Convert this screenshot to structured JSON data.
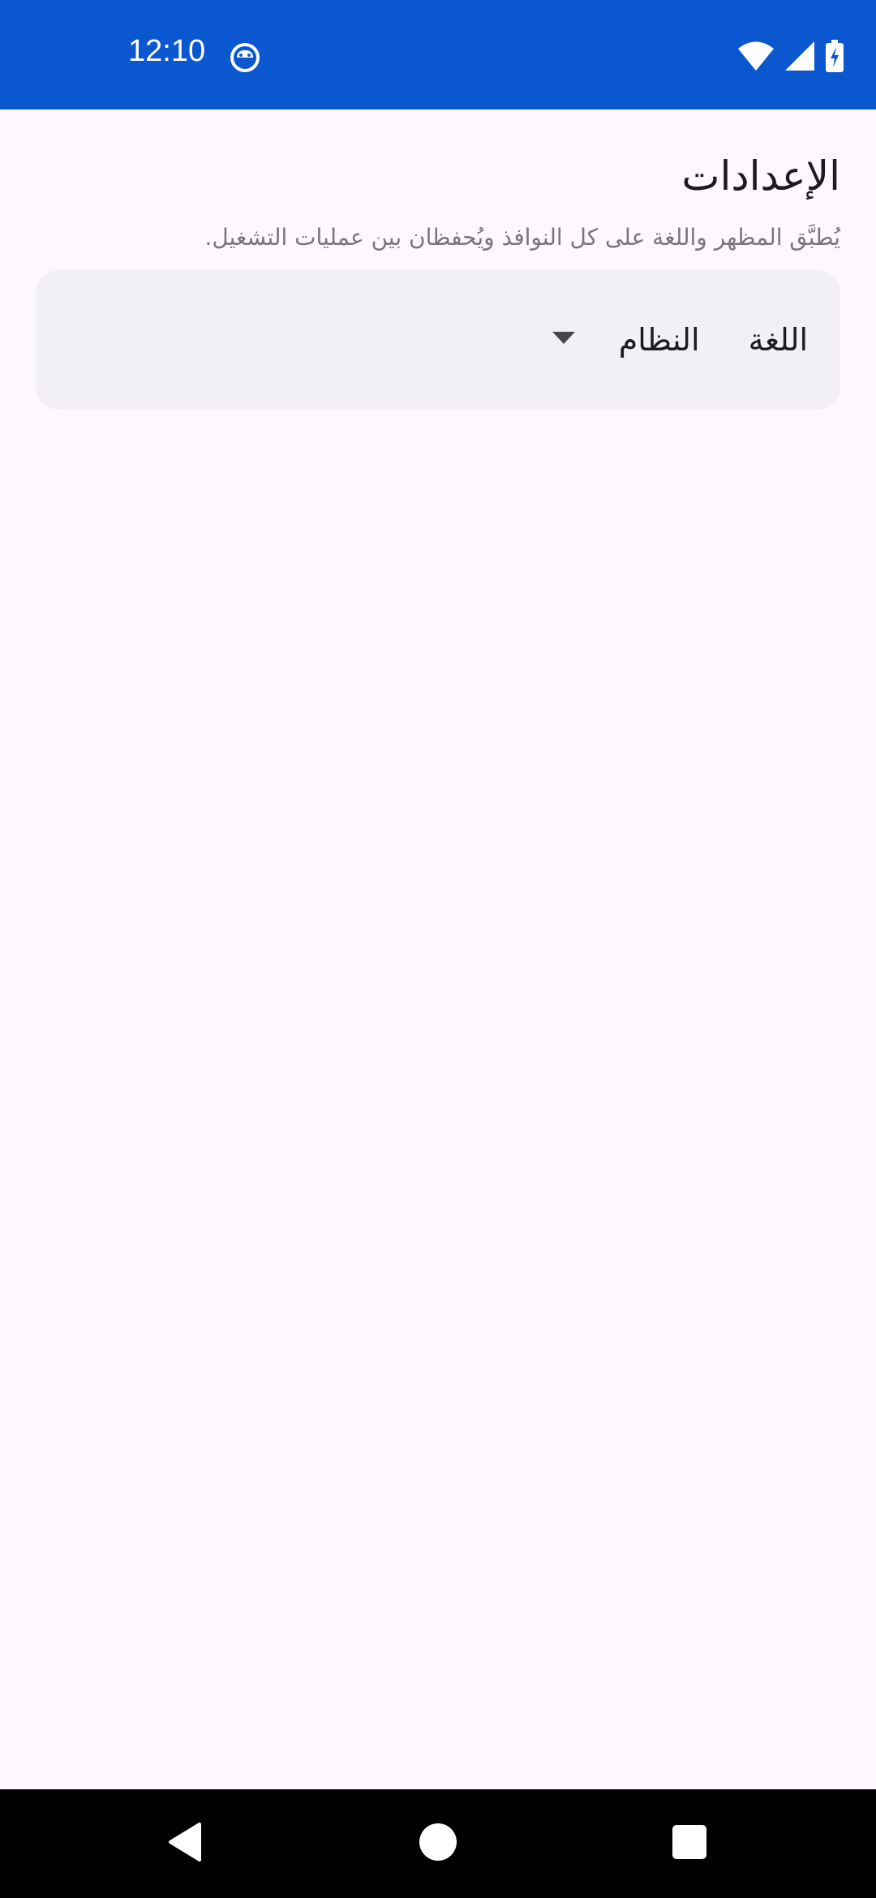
{
  "status_bar": {
    "time": "12:10",
    "background_color": "#0b57d0",
    "icons": [
      "app-notification-icon",
      "wifi-icon",
      "cellular-signal-icon",
      "battery-charging-icon"
    ]
  },
  "settings": {
    "title": "الإعدادات",
    "subtitle": "يُطبَّق المظهر واللغة على كل النوافذ ويُحفظان بين عمليات التشغيل.",
    "language": {
      "label": "اللغة",
      "selected_value": "النظام",
      "dropdown_icon": "dropdown-arrow-icon"
    }
  },
  "navigation_bar": {
    "buttons": [
      "back-icon",
      "home-icon",
      "recents-icon"
    ]
  }
}
